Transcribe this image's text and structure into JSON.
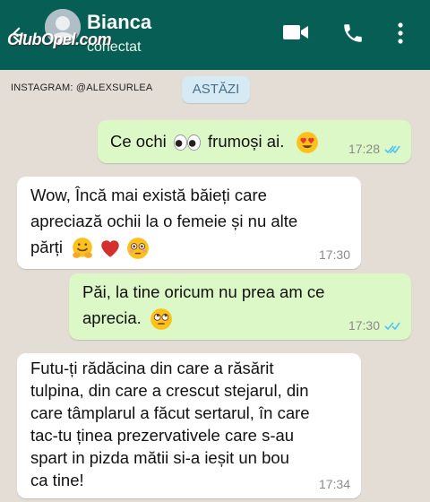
{
  "header": {
    "contact_name": "Bianca",
    "status": "conectat",
    "watermark": "ClubOpel.com",
    "colors": {
      "bar": "#075e54",
      "text": "#ffffff"
    },
    "icons": [
      "back-arrow-icon",
      "video-call-icon",
      "phone-icon",
      "more-options-icon"
    ]
  },
  "chat": {
    "watermark_text": "INSTAGRAM: @ALEXSURLEA",
    "date_chip": "ASTĂZI",
    "messages": [
      {
        "direction": "out",
        "lines": [
          "Ce ochi",
          "frumoși ai."
        ],
        "time": "17:28",
        "read": true
      },
      {
        "direction": "in",
        "lines": [
          "Wow, Încă mai există băieți care",
          "apreciază ochii la o femeie și nu alte",
          "părți"
        ],
        "time": "17:30"
      },
      {
        "direction": "out",
        "lines": [
          "Păi, la tine oricum nu prea am ce",
          "aprecia."
        ],
        "time": "17:30",
        "read": true
      },
      {
        "direction": "in",
        "lines": [
          "Futu-ți rădăcina din care a răsărit",
          "tulpina, din care a crescut stejarul, din",
          "care tâmplarul a făcut sertarul, în care",
          "tac-tu ținea prezervativele care s-au",
          "spart in pizda mătii si-a ieșit un bou",
          "ca tine!"
        ],
        "time": "17:34"
      }
    ],
    "colors": {
      "background": "#e4ddd5",
      "outgoing": "#dcf8c6",
      "incoming": "#ffffff",
      "read_ticks": "#4fc3f7"
    }
  }
}
